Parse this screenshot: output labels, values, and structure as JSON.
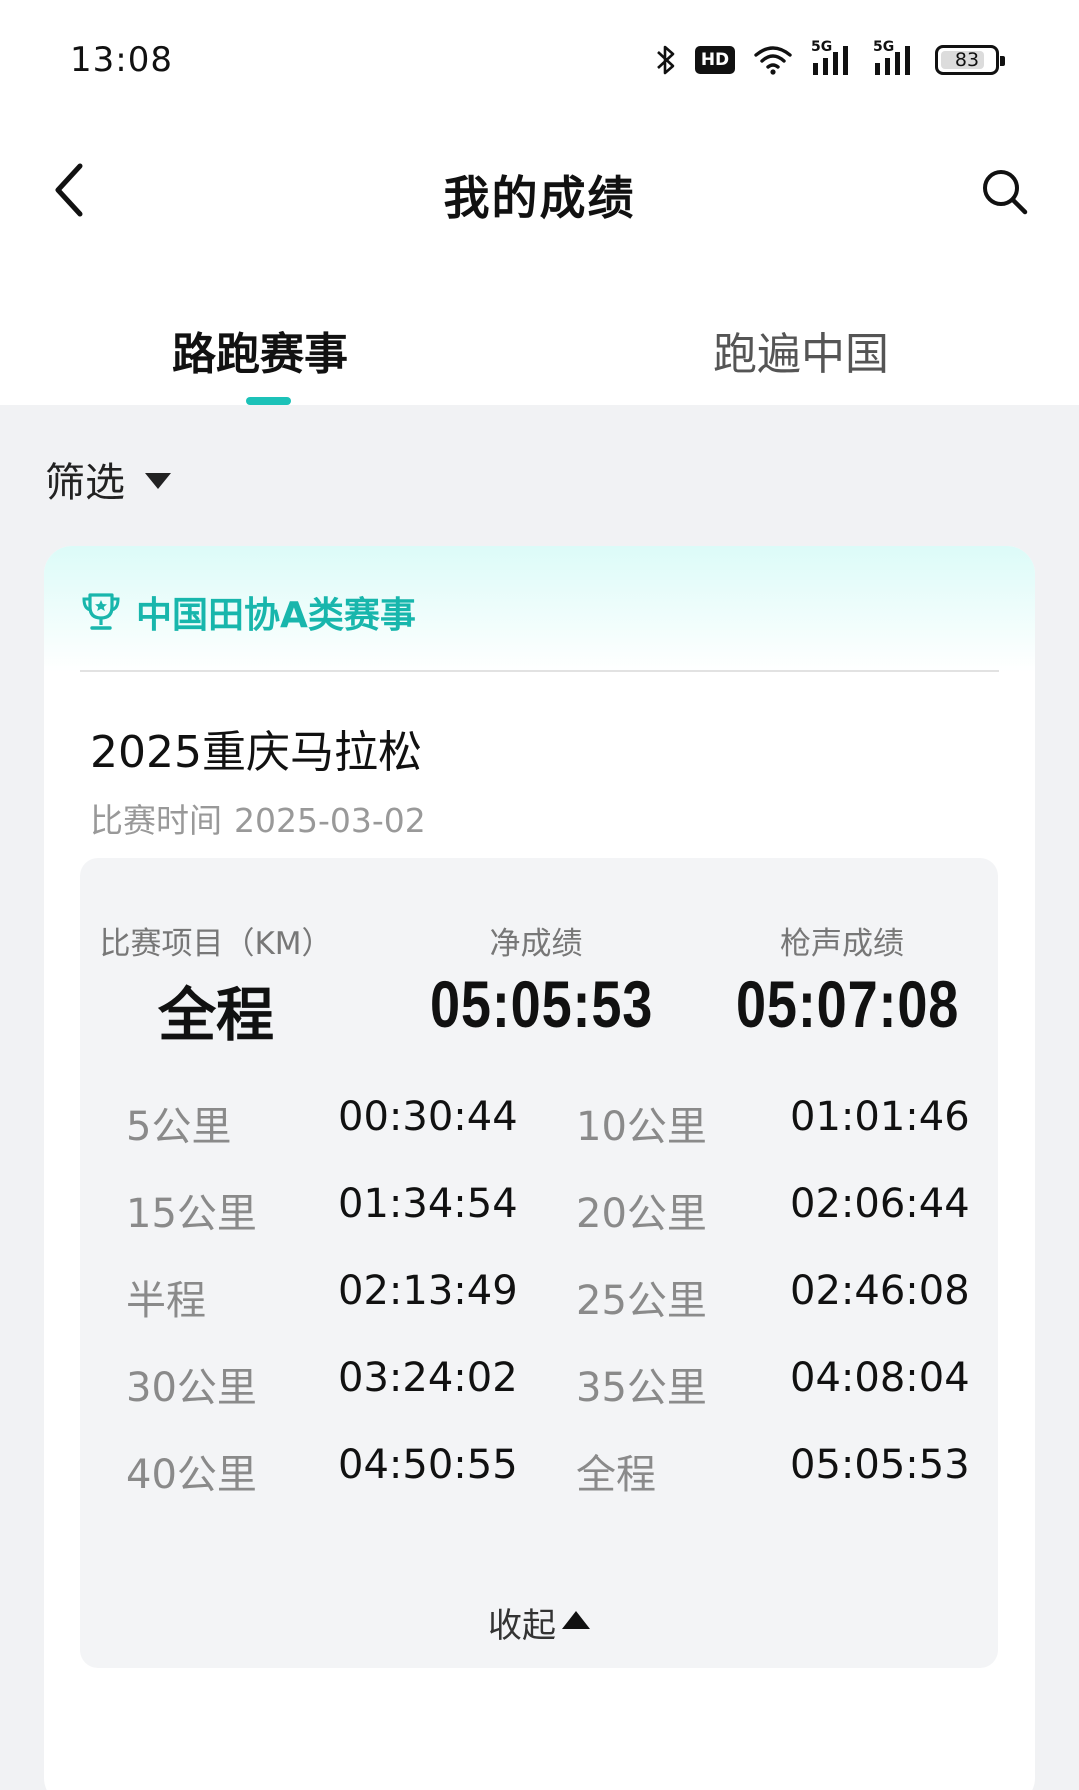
{
  "status_bar": {
    "time": "13:08",
    "hd_label": "HD",
    "network_1": "5G",
    "network_2": "5G",
    "battery": "83",
    "battery_percent": 83
  },
  "nav": {
    "title": "我的成绩",
    "back_icon": "chevron-left-icon",
    "search_icon": "search-icon"
  },
  "tabs": [
    {
      "label": "路跑赛事",
      "active": true
    },
    {
      "label": "跑遍中国",
      "active": false
    }
  ],
  "filter": {
    "label": "筛选"
  },
  "colors": {
    "accent": "#1cc2b8",
    "category_text": "#18b6ac"
  },
  "card": {
    "category": "中国田协A类赛事",
    "category_icon": "trophy-icon",
    "race_name": "2025重庆马拉松",
    "date_label": "比赛时间",
    "date": "2025-03-02",
    "headers": {
      "event": "比赛项目（KM）",
      "net": "净成绩",
      "gun": "枪声成绩"
    },
    "event": "全程",
    "net_time": "05:05:53",
    "gun_time": "05:07:08",
    "splits": [
      {
        "label1": "5公里",
        "value1": "00:30:44",
        "label2": "10公里",
        "value2": "01:01:46"
      },
      {
        "label1": "15公里",
        "value1": "01:34:54",
        "label2": "20公里",
        "value2": "02:06:44"
      },
      {
        "label1": "半程",
        "value1": "02:13:49",
        "label2": "25公里",
        "value2": "02:46:08"
      },
      {
        "label1": "30公里",
        "value1": "03:24:02",
        "label2": "35公里",
        "value2": "04:08:04"
      },
      {
        "label1": "40公里",
        "value1": "04:50:55",
        "label2": "全程",
        "value2": "05:05:53"
      }
    ],
    "collapse_label": "收起"
  }
}
